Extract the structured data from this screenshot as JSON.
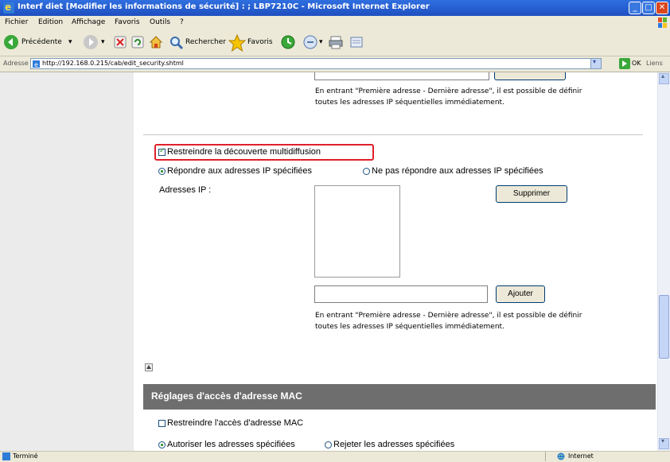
{
  "window": {
    "title": "Interf diet [Modifier les informations de sécurité] : ; LBP7210C - Microsoft Internet Explorer"
  },
  "menubar": {
    "items": [
      "Fichier",
      "Edition",
      "Affichage",
      "Favoris",
      "Outils",
      "?"
    ]
  },
  "toolbar": {
    "back_label": "Précédente",
    "search_label": "Rechercher",
    "favorites_label": "Favoris"
  },
  "addressbar": {
    "label": "Adresse",
    "url": "http://192.168.0.215/cab/edit_security.shtml",
    "go_label": "OK",
    "links_label": "Liens"
  },
  "content": {
    "note_text_1": "En entrant \"Première adresse - Dernière adresse\", il est possible de définir",
    "note_text_2": "toutes les adresses IP séquentielles immédiatement.",
    "multicast_checkbox_label": "Restreindre la découverte multidiffusion",
    "radio_respond_label": "Répondre aux adresses IP spécifiées",
    "radio_no_respond_label": "Ne pas répondre aux adresses IP spécifiées",
    "ip_addresses_label": "Adresses IP :",
    "delete_button": "Supprimer",
    "add_button": "Ajouter",
    "ip_input_value": "",
    "mac_section_title": "Réglages d'accès d'adresse MAC",
    "mac_checkbox_label": "Restreindre l'accès d'adresse MAC",
    "mac_radio_allow_label": "Autoriser les adresses spécifiées",
    "mac_radio_reject_label": "Rejeter les adresses spécifiées"
  },
  "statusbar": {
    "status_text": "Terminé",
    "zone_text": "Internet"
  },
  "colors": {
    "highlight_border": "#e0202a",
    "section_header_bg": "#6e6e6e",
    "titlebar": "#245edb"
  }
}
